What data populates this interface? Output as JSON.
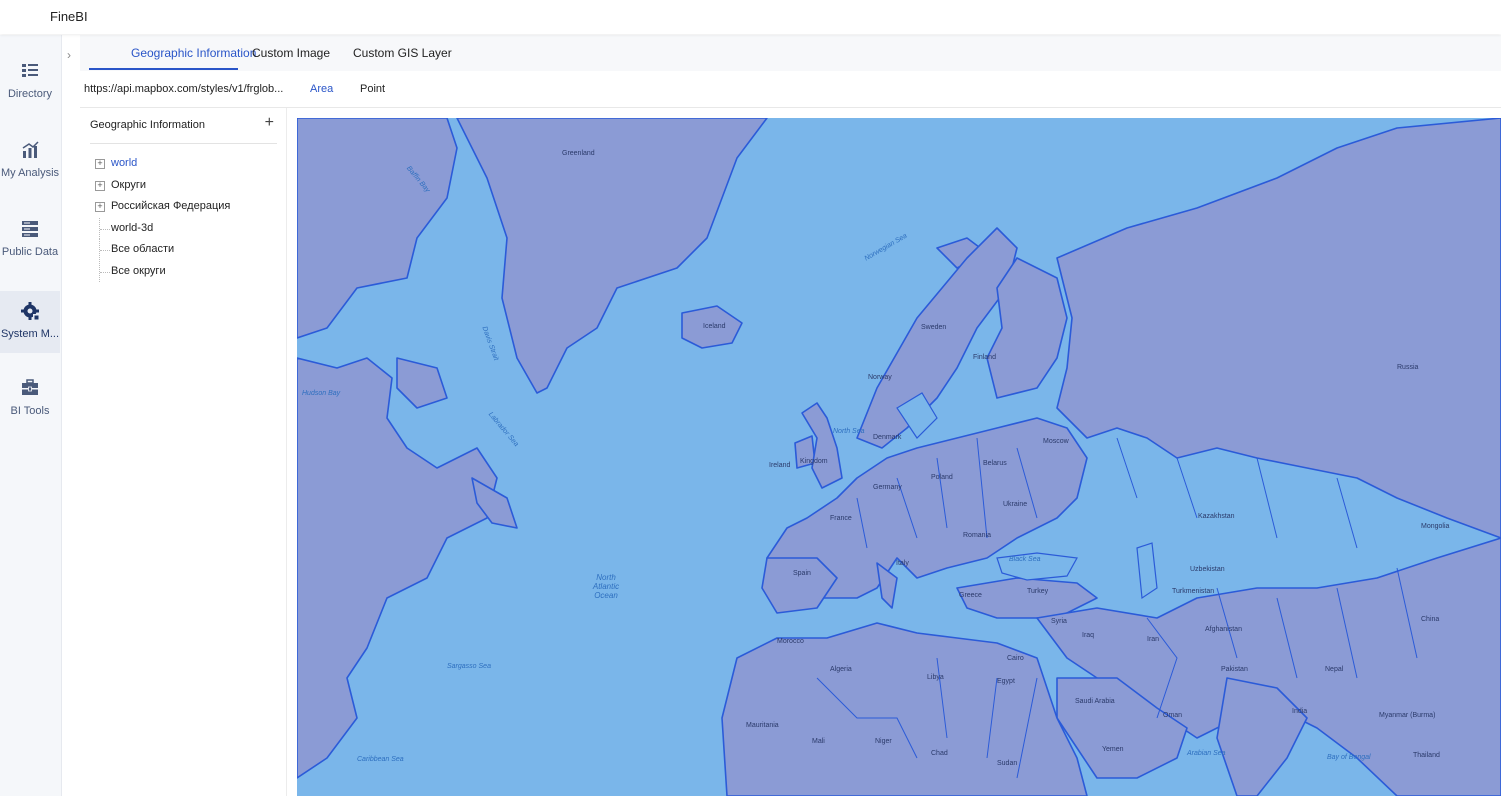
{
  "app": {
    "title": "FineBI"
  },
  "sidebar": {
    "items": [
      {
        "label": "Directory",
        "icon": "directory-icon"
      },
      {
        "label": "My Analysis",
        "icon": "analysis-chart-icon"
      },
      {
        "label": "Public Data",
        "icon": "database-icon"
      },
      {
        "label": "System M...",
        "icon": "gear-icon",
        "active": true
      },
      {
        "label": "BI Tools",
        "icon": "toolbox-icon"
      }
    ]
  },
  "tabs": [
    {
      "label": "Geographic Information",
      "active": true
    },
    {
      "label": "Custom Image"
    },
    {
      "label": "Custom GIS Layer"
    }
  ],
  "toolbar": {
    "url": "https://api.mapbox.com/styles/v1/frglob...",
    "modes": [
      {
        "label": "Area",
        "active": true
      },
      {
        "label": "Point"
      }
    ]
  },
  "panel": {
    "title": "Geographic Information",
    "add_icon": "plus-icon",
    "tree": [
      {
        "label": "world",
        "expandable": true,
        "selected": true
      },
      {
        "label": "Округи",
        "expandable": true
      },
      {
        "label": "Российская Федерация",
        "expandable": true
      },
      {
        "label": "world-3d",
        "expandable": false
      },
      {
        "label": "Все области",
        "expandable": false
      },
      {
        "label": "Все округи",
        "expandable": false
      }
    ]
  },
  "map": {
    "colors": {
      "ocean": "#7ab6ea",
      "land": "#8b9bd5",
      "border": "#2b5bd8"
    },
    "labels": {
      "greenland": "Greenland",
      "iceland": "Iceland",
      "russia": "Russia",
      "sweden": "Sweden",
      "finland": "Finland",
      "norway": "Norway",
      "denmark": "Denmark",
      "ireland": "Ireland",
      "kingdom": "Kingdom",
      "germany": "Germany",
      "poland": "Poland",
      "belarus": "Belarus",
      "ukraine": "Ukraine",
      "france": "France",
      "spain": "Spain",
      "italy": "Italy",
      "romania": "Romania",
      "greece": "Greece",
      "turkey": "Turkey",
      "syria": "Syria",
      "iraq": "Iraq",
      "iran": "Iran",
      "kazakhstan": "Kazakhstan",
      "uzbekistan": "Uzbekistan",
      "turkmenistan": "Turkmenistan",
      "afghanistan": "Afghanistan",
      "pakistan": "Pakistan",
      "mongolia": "Mongolia",
      "china": "China",
      "morocco": "Morocco",
      "algeria": "Algeria",
      "libya": "Libya",
      "egypt": "Egypt",
      "saudi": "Saudi Arabia",
      "mauritania": "Mauritania",
      "mali": "Mali",
      "niger": "Niger",
      "chad": "Chad",
      "sudan": "Sudan",
      "yemen": "Yemen",
      "oman": "Oman",
      "india": "India",
      "myanmar": "Myanmar (Burma)",
      "thailand": "Thailand",
      "nepal": "Nepal",
      "moscow": "Moscow",
      "cairo": "Cairo",
      "baffin": "Baffin Bay",
      "davis": "Davis Strait",
      "labrador": "Labrador Sea",
      "norwegian": "Norwegian Sea",
      "north_sea": "North Sea",
      "atlantic": "North Atlantic Ocean",
      "sargasso": "Sargasso Sea",
      "arabian": "Arabian Sea",
      "bengal": "Bay of Bengal",
      "black_sea": "Black Sea",
      "caribbean": "Caribbean Sea",
      "hudson": "Hudson Bay"
    }
  }
}
